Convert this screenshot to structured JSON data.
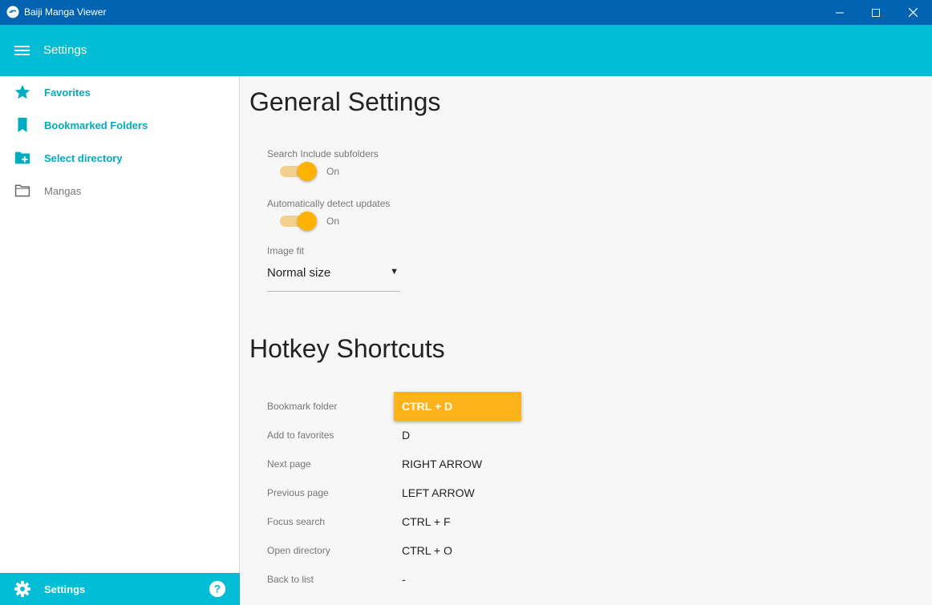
{
  "window": {
    "title": "Baiji Manga Viewer"
  },
  "appbar": {
    "title": "Settings"
  },
  "sidebar": {
    "items": [
      {
        "label": "Favorites",
        "icon": "star-icon"
      },
      {
        "label": "Bookmarked Folders",
        "icon": "bookmark-icon"
      },
      {
        "label": "Select directory",
        "icon": "folder-add-icon"
      },
      {
        "label": "Mangas",
        "icon": "folder-outline-icon"
      }
    ],
    "footer": {
      "label": "Settings",
      "icon": "gear-icon",
      "help_icon": "help-icon"
    }
  },
  "general": {
    "heading": "General Settings",
    "include_subfolders": {
      "label": "Search Include subfolders",
      "state": "On",
      "enabled": true
    },
    "detect_updates": {
      "label": "Automatically detect updates",
      "state": "On",
      "enabled": true
    },
    "image_fit": {
      "label": "Image fit",
      "value": "Normal size"
    }
  },
  "hotkeys": {
    "heading": "Hotkey Shortcuts",
    "rows": [
      {
        "label": "Bookmark folder",
        "value": "CTRL + D"
      },
      {
        "label": "Add to favorites",
        "value": "D"
      },
      {
        "label": "Next page",
        "value": "RIGHT ARROW"
      },
      {
        "label": "Previous page",
        "value": "LEFT ARROW"
      },
      {
        "label": "Focus search",
        "value": "CTRL + F"
      },
      {
        "label": "Open directory",
        "value": "CTRL + O"
      },
      {
        "label": "Back to list",
        "value": "-"
      }
    ]
  },
  "colors": {
    "titlebar": "#0063b1",
    "accent": "#00bcd4",
    "toggle": "#ffb300",
    "highlight": "#ffb31a"
  }
}
